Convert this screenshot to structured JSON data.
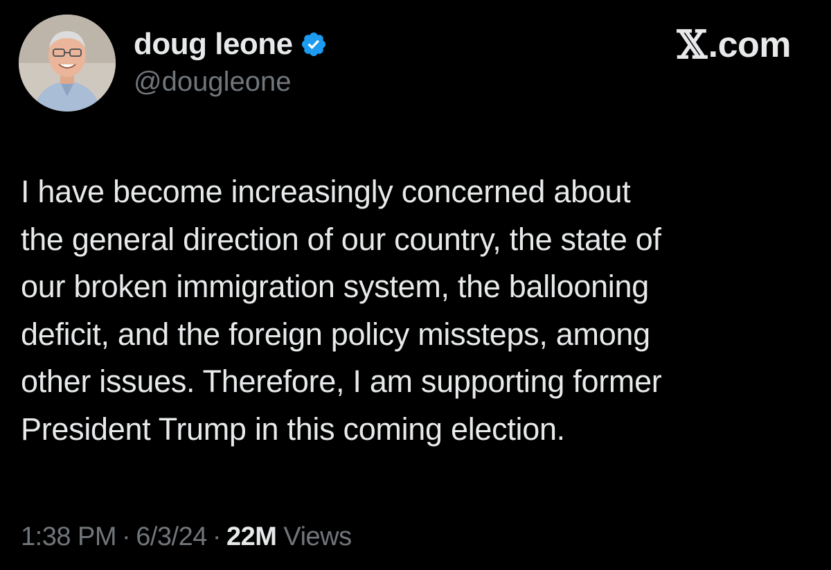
{
  "author": {
    "display_name": "doug leone",
    "handle": "@dougleone",
    "verified_icon": "verified-badge-icon",
    "verified_color": "#1d9bf0"
  },
  "brand": {
    "x_glyph": "𝕏",
    "text": ".com"
  },
  "tweet": {
    "text": "I have become increasingly concerned about\nthe general direction of our country, the state of\nour broken immigration system, the ballooning\ndeficit, and the foreign policy missteps, among\nother issues. Therefore, I am supporting former\nPresident Trump in this coming election."
  },
  "meta": {
    "time": "1:38 PM",
    "separator": "·",
    "date": "6/3/24",
    "views_count": "22M",
    "views_label": "Views"
  },
  "colors": {
    "background": "#000000",
    "primary_text": "#e7e9ea",
    "secondary_text": "#71767b"
  }
}
